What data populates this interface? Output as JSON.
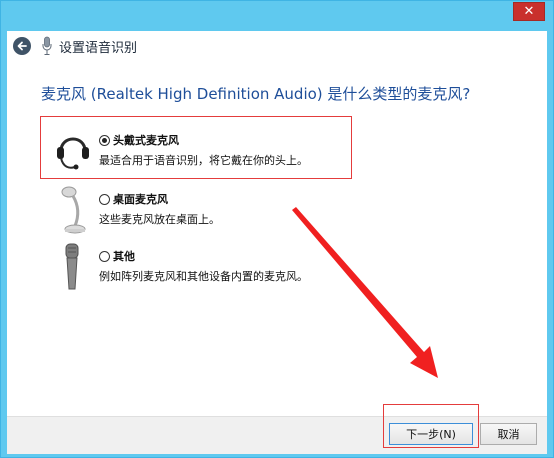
{
  "window": {
    "close_symbol": "✕",
    "accent_color": "#5fc9ef"
  },
  "header": {
    "back_icon": "back-arrow-icon",
    "mic_icon": "microphone-icon",
    "title": "设置语音识别"
  },
  "question": "麦克风 (Realtek High Definition Audio) 是什么类型的麦克风?",
  "options": [
    {
      "label": "头戴式麦克风",
      "description": "最适合用于语音识别，将它戴在你的头上。",
      "icon": "headset-icon",
      "selected": true
    },
    {
      "label": "桌面麦克风",
      "description": "这些麦克风放在桌面上。",
      "icon": "desktop-mic-icon",
      "selected": false
    },
    {
      "label": "其他",
      "description": "例如阵列麦克风和其他设备内置的麦克风。",
      "icon": "handheld-mic-icon",
      "selected": false
    }
  ],
  "footer": {
    "next_label": "下一步(N)",
    "cancel_label": "取消"
  },
  "annotation_color": "#e43c3c"
}
